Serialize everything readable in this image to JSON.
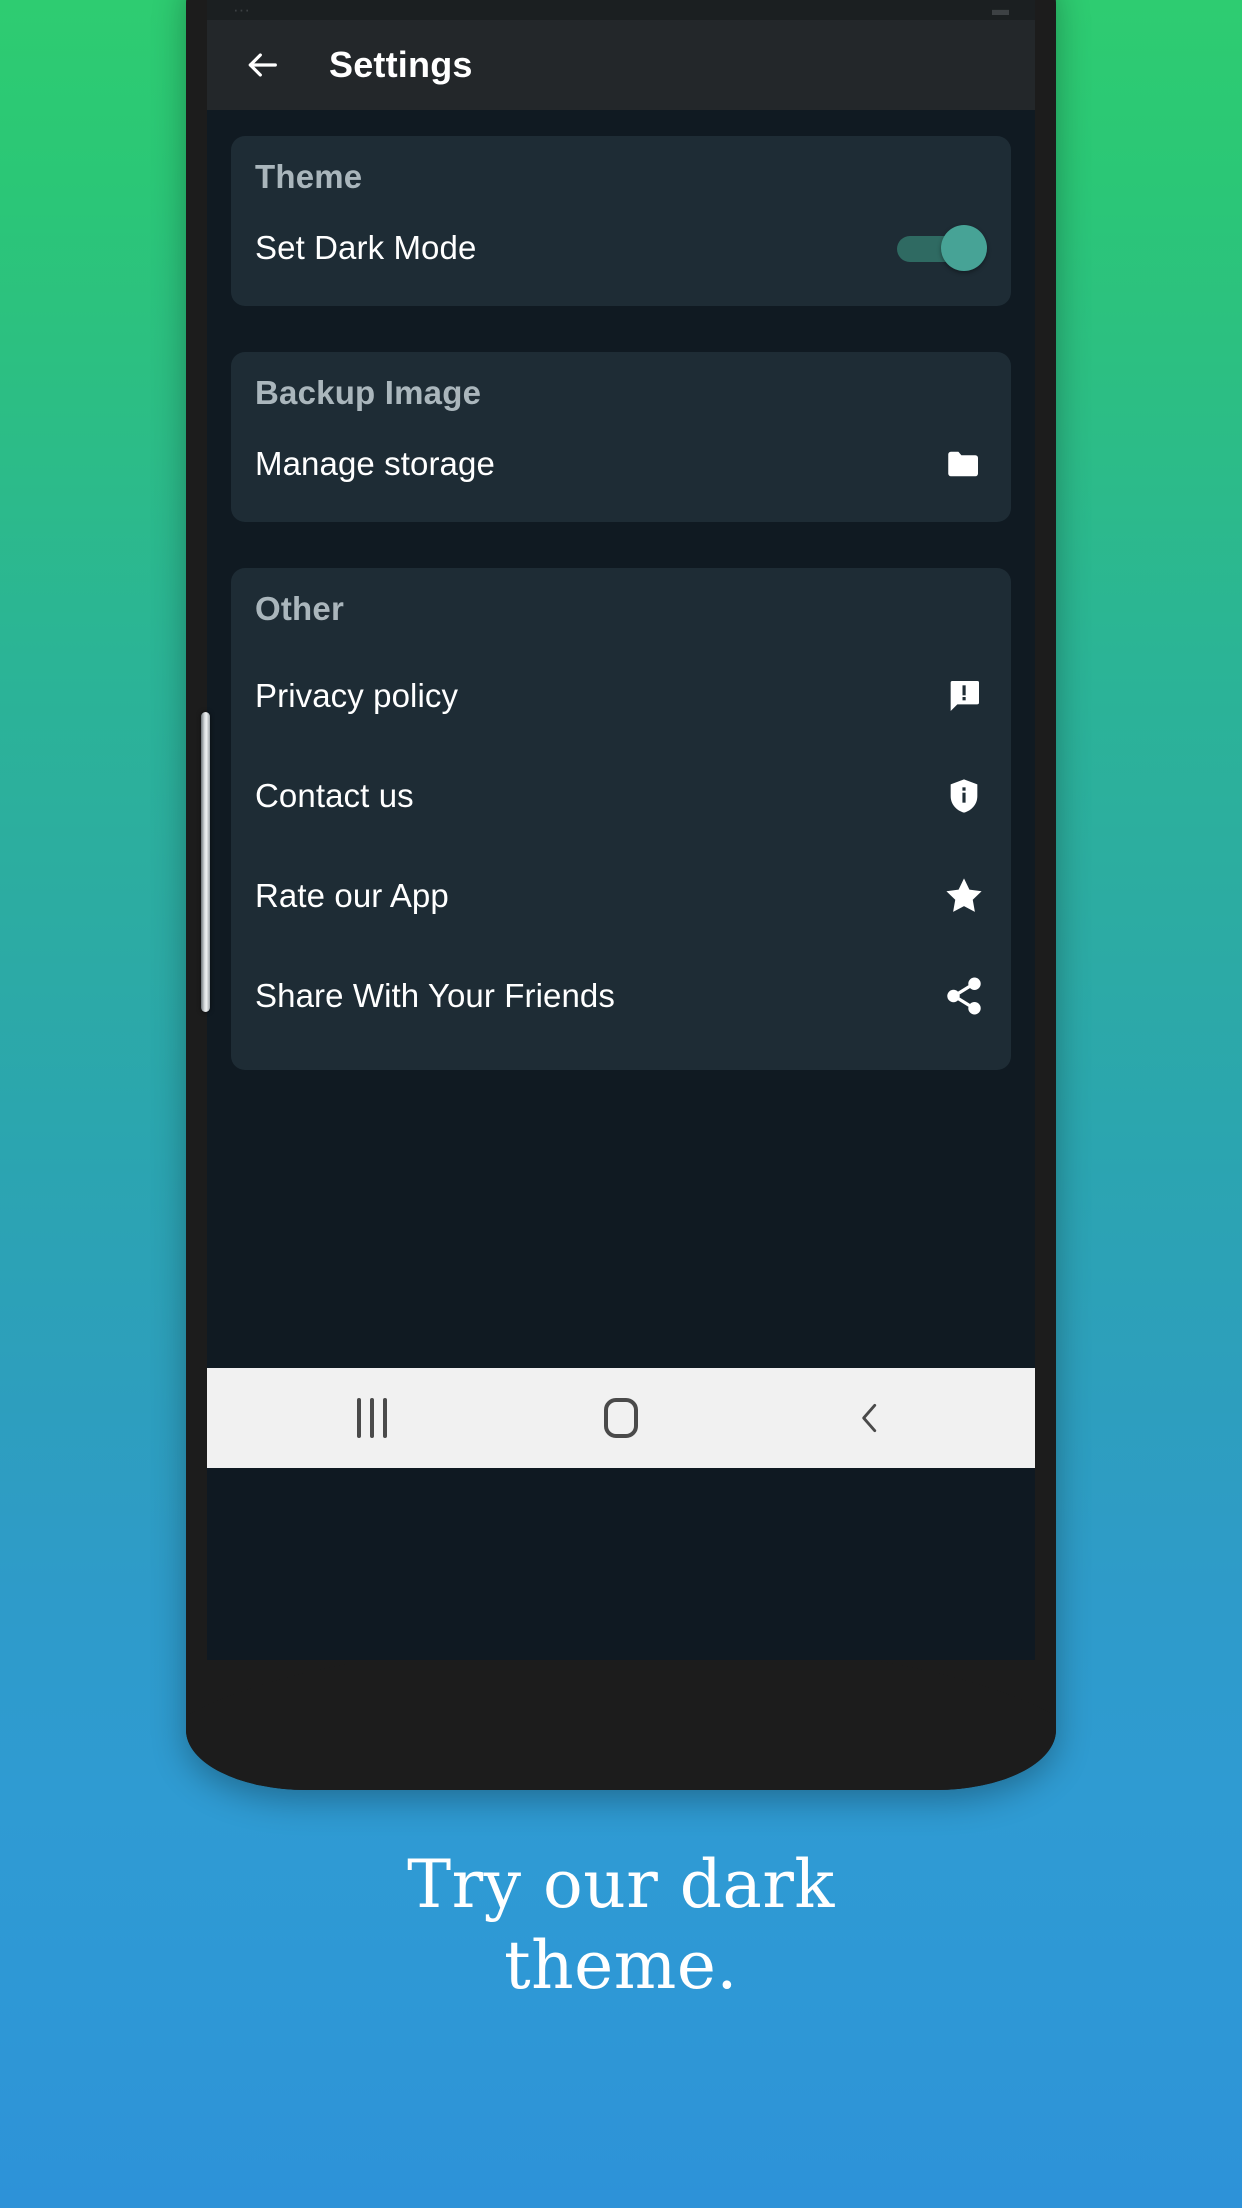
{
  "caption": {
    "line1": "Try our dark",
    "line2": "theme."
  },
  "statusbar": {
    "left": "···",
    "right": "▬"
  },
  "appbar": {
    "title": "Settings",
    "back_icon": "arrow-left-icon"
  },
  "sections": [
    {
      "id": "theme",
      "title": "Theme",
      "rows": [
        {
          "label": "Set Dark Mode",
          "control": "toggle",
          "state": "on"
        }
      ]
    },
    {
      "id": "backup-image",
      "title": "Backup Image",
      "rows": [
        {
          "label": "Manage storage",
          "control": "icon",
          "icon": "folder-icon"
        }
      ]
    },
    {
      "id": "other",
      "title": "Other",
      "rows": [
        {
          "label": "Privacy policy",
          "control": "icon",
          "icon": "feedback-icon"
        },
        {
          "label": "Contact us",
          "control": "icon",
          "icon": "shield-info-icon"
        },
        {
          "label": "Rate our App",
          "control": "icon",
          "icon": "star-icon"
        },
        {
          "label": "Share With Your Friends",
          "control": "icon",
          "icon": "share-icon"
        }
      ]
    }
  ],
  "navbar": {
    "recents_label": "recents-icon",
    "home_label": "home-icon",
    "back_label": "back-icon"
  },
  "colors": {
    "bg_gradient_top": "#2ECC71",
    "bg_gradient_bottom": "#2D92D8",
    "screen_bg": "#101a22",
    "card_bg": "#1e2c35",
    "appbar_bg": "#23272a",
    "accent_toggle": "#47A396",
    "text_primary": "#ffffff",
    "text_heading": "#aab6bc",
    "navbar_bg": "#f1f1f1"
  }
}
